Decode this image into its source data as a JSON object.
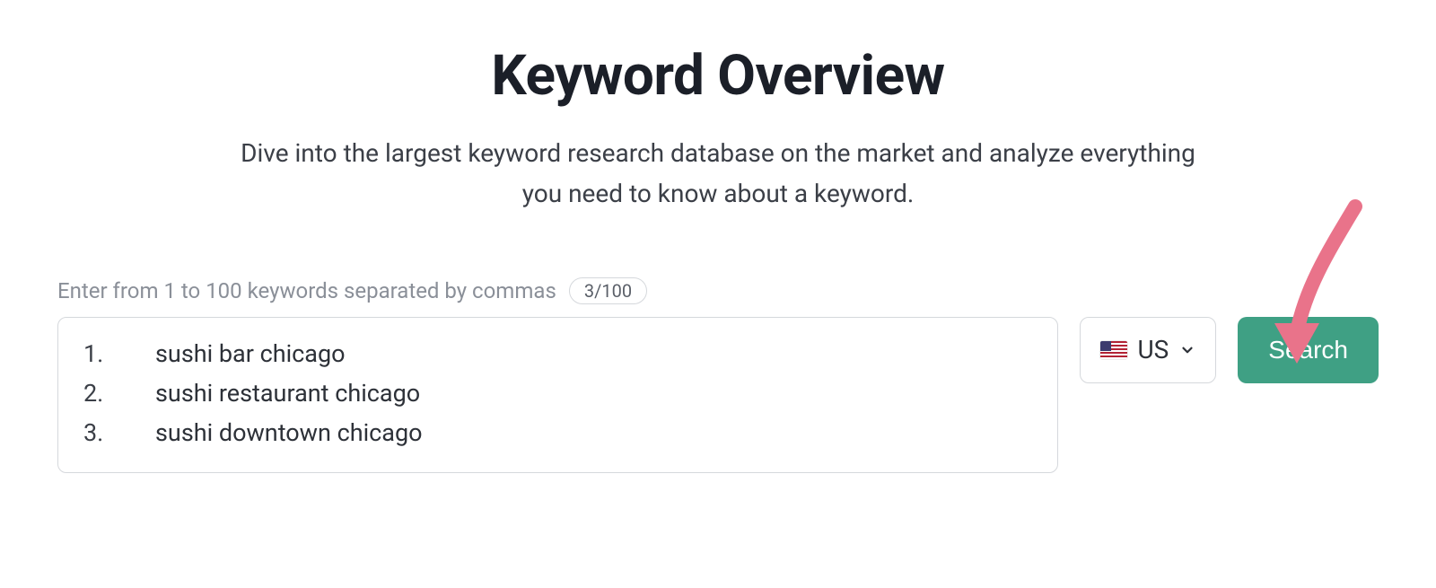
{
  "title": "Keyword Overview",
  "subtitle": "Dive into the largest keyword research database on the market and analyze everything you need to know about a keyword.",
  "input": {
    "label": "Enter from 1 to 100 keywords separated by commas",
    "count_pill": "3/100",
    "keywords": [
      {
        "num": "1.",
        "text": "sushi bar chicago"
      },
      {
        "num": "2.",
        "text": "sushi restaurant chicago"
      },
      {
        "num": "3.",
        "text": "sushi downtown chicago"
      }
    ]
  },
  "country": {
    "label": "US"
  },
  "search_label": "Search"
}
